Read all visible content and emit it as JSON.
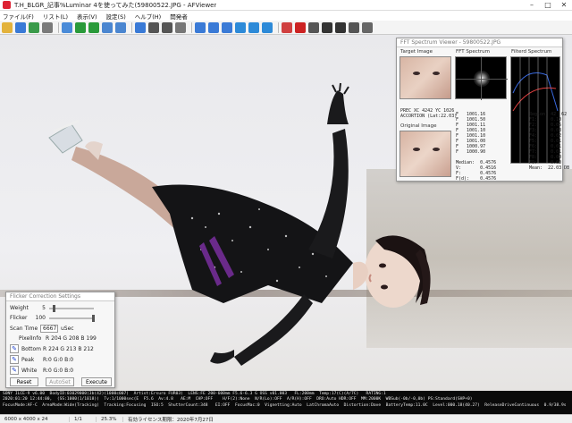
{
  "window": {
    "title": "T.H_BLGR_記事%Luminar 4を使ってみた(59800522.JPG - AFViewer",
    "controls": [
      "–",
      "□",
      "✕"
    ]
  },
  "menu": [
    "ファイル(F)",
    "リスト(L)",
    "表示(V)",
    "設定(S)",
    "ヘルプ(H)",
    "開発者"
  ],
  "toolbar": {
    "icons": [
      "folder-icon",
      "up-folder-icon",
      "folder-tree-icon",
      "fullscreen-icon",
      "refresh-icon",
      "back-icon",
      "forward-icon",
      "prev-icon",
      "next-icon",
      "info-icon",
      "compare-icon",
      "grid-icon",
      "histogram-icon",
      "zoom-in-icon",
      "zoom-out-icon",
      "fit-icon",
      "rotate-left-icon",
      "rotate-right-icon",
      "flip-icon",
      "mark-icon",
      "record-icon",
      "clip-icon",
      "filter-icon",
      "run-icon",
      "script-icon",
      "settings-icon"
    ],
    "colors": [
      "#e3b23c",
      "#3a7ad6",
      "#3a9a4a",
      "#7a7a7a",
      "#4a8bd8",
      "#2a9a3a",
      "#2a9a3a",
      "#4b86d0",
      "#4b86d0",
      "#3a7ad6",
      "#555555",
      "#555555",
      "#777777",
      "#3a7ad6",
      "#3a7ad6",
      "#3a7ad6",
      "#2d8ad8",
      "#2d8ad8",
      "#2d8ad8",
      "#d04040",
      "#cc2222",
      "#555555",
      "#333333",
      "#333333",
      "#555555",
      "#666666"
    ]
  },
  "fft_viewer": {
    "title": "FFT Spectrum Viewer - 59800522.JPG",
    "target_label": "Target Image",
    "spectrum_label": "FFT Spectrum",
    "filtered_label": "Filterd Spectrum",
    "original_label": "Original Image",
    "left_text": "PREC XC 4242 YC 1026\nACCORTION (Lat:22.03)",
    "right_text": "Region: 42  62\nF1:     0.10\nF2:     0.05\nF3:     0.03\nF4:     0.02\nF5:     0.01\nF6:     0.01\nF7:     0.01\nF8:     0.00\nF9:     0.00\nMean:  22.03 DB",
    "mid_text": "F   1001.16\nF   1001.50\nF   1001.11\nF   1001.10\nF   1001.10\nF   1001.00\nF   1000.97\nF   1000.90\n\nMedian:  0.4576\nV:       0.4516\nF:       0.4576\nF(d):    0.4576"
  },
  "flicker": {
    "title": "Flicker Correction Settings",
    "weight_label": "Weight",
    "weight_value": "5",
    "flicker_label": "Flicker",
    "flicker_value": "100",
    "scan_label": "Scan Time",
    "scan_value": "6667",
    "scan_unit": "uSec",
    "pixelinfo_label": "PixelInfo",
    "pixelinfo_value": "R 204  G 208  B 199",
    "bottom_label": "Bottom",
    "bottom_value": "R 224  G 213  B 212",
    "peak_label": "Peak",
    "peak_value": "R:0    G:0    B:0",
    "white_label": "White",
    "white_value": "R:0    G:0    B:0",
    "reset_label": "Reset",
    "autoset_label": "AutoSet",
    "execute_label": "Execute"
  },
  "infobar": {
    "line1": "SONY ILCE-9 v6.00  BodyID:03029000(3b(42)(1000c007)  Artist:Ersuro FUR03)  LENS:FE 200-600mm F5.6-6.3 G OSS v01.003   FL:200mm  Temp:17(C)(A/7C)   RATING:1",
    "line2": "2020:01:20 12:44:00,  (SS:1000(1/1018))  Tv:1/1000sec(E  F5.6  Av:4.8   AE:M  CHP:OFF    H/F(2):None  N/R(Lo):OFF  A/R(H):OFF  DRO:Auto HDR:OFF  MM:2000K  WBSub(-0b/-0,0b) PS:Standard(SHP+0)",
    "line3": "FocusMode:AF-C  AreaMode:Wide(Tracking)  Tracking:Focusing  ISO:5  ShutterCount:348   EI:OFF  FocusMac:0  Vignetting:Auto  LatChromaAuto  Distortion:Dave  BatteryTemp:11.0C  Level:000.18(40.27)  ReleaseDriveContinuous  0.9/38.9s"
  },
  "status": {
    "dims": "6000 x 4000 x 24",
    "page": "1/1",
    "zoom": "25.3%",
    "license": "有効ライセンス期限：2020年7月27日"
  }
}
